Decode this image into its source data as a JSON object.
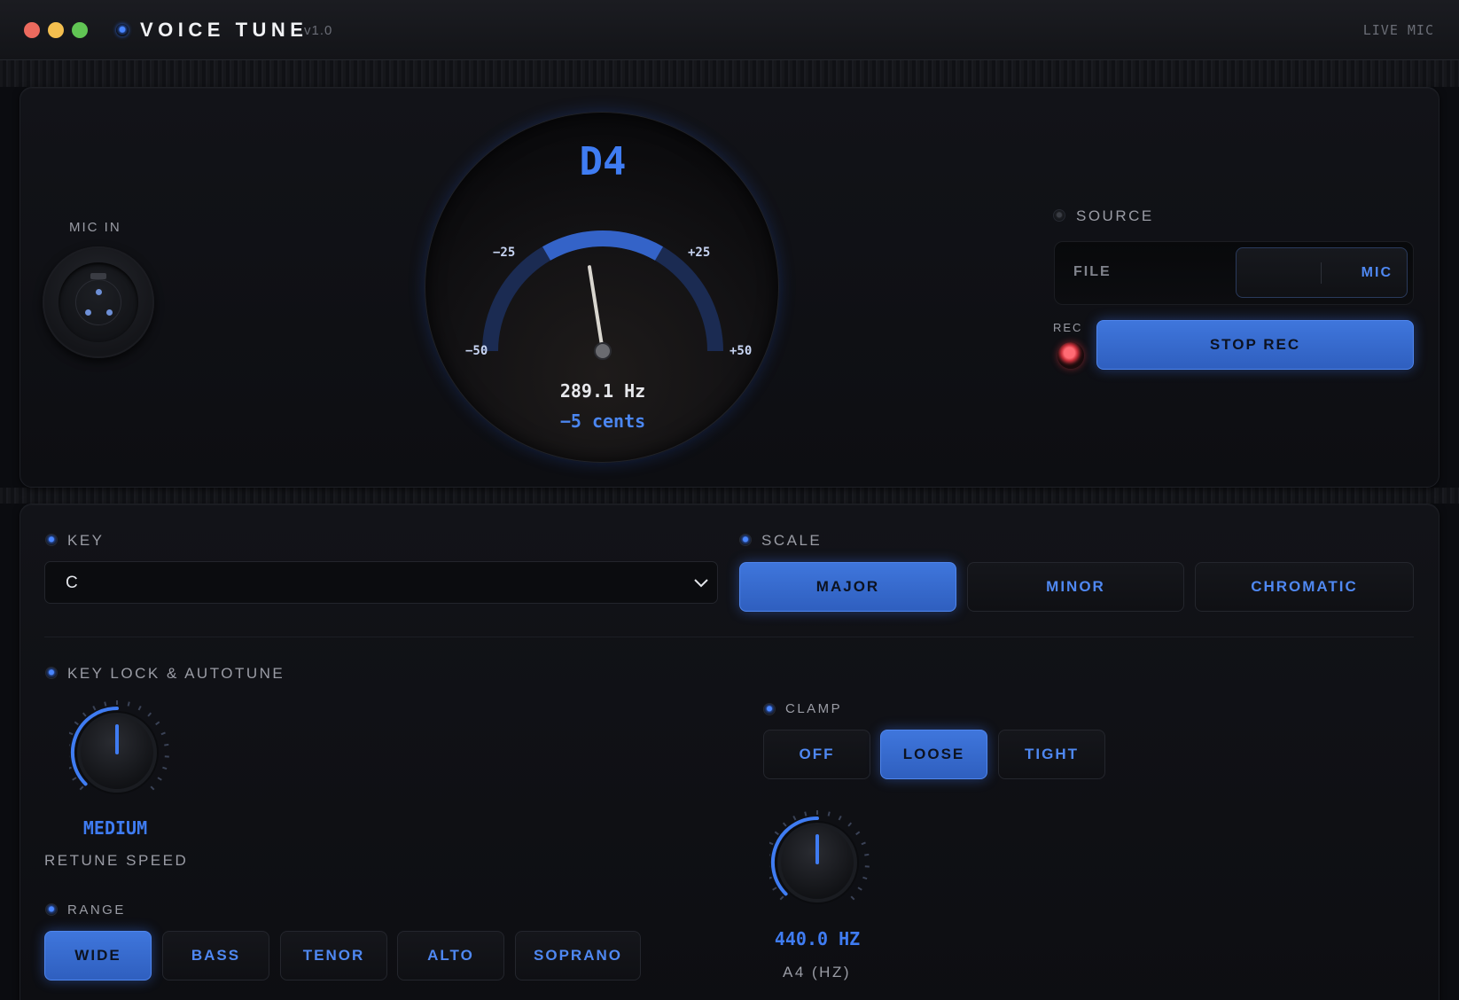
{
  "window": {
    "title": "VOICE TUNE",
    "version": "v1.0",
    "mode": "LIVE MIC"
  },
  "input": {
    "label": "MIC IN"
  },
  "meter": {
    "note": "D4",
    "frequency": "289.1 Hz",
    "cents_text": "−5 cents",
    "cents_value": -5,
    "scale_labels": {
      "minus50": "−50",
      "minus25": "−25",
      "plus25": "+25",
      "plus50": "+50"
    }
  },
  "source": {
    "label": "SOURCE",
    "options": [
      "FILE",
      "MIC"
    ],
    "selected": "MIC"
  },
  "record": {
    "label": "REC",
    "button": "STOP REC"
  },
  "key": {
    "label": "KEY",
    "value": "C"
  },
  "scale": {
    "label": "SCALE",
    "options": [
      "MAJOR",
      "MINOR",
      "CHROMATIC"
    ],
    "selected": "MAJOR"
  },
  "autotune": {
    "label": "KEY LOCK & AUTOTUNE",
    "speed_value": "MEDIUM",
    "speed_label": "RETUNE SPEED",
    "speed_level": 0.5
  },
  "range": {
    "label": "RANGE",
    "options": [
      "WIDE",
      "BASS",
      "TENOR",
      "ALTO",
      "SOPRANO"
    ],
    "selected": "WIDE"
  },
  "clamp": {
    "label": "CLAMP",
    "options": [
      "OFF",
      "LOOSE",
      "TIGHT"
    ],
    "selected": "LOOSE"
  },
  "tuning": {
    "value": "440.0 HZ",
    "label": "A4 (HZ)",
    "level": 0.5
  },
  "colors": {
    "accent": "#3f7cf2",
    "rec": "#e0404a"
  }
}
